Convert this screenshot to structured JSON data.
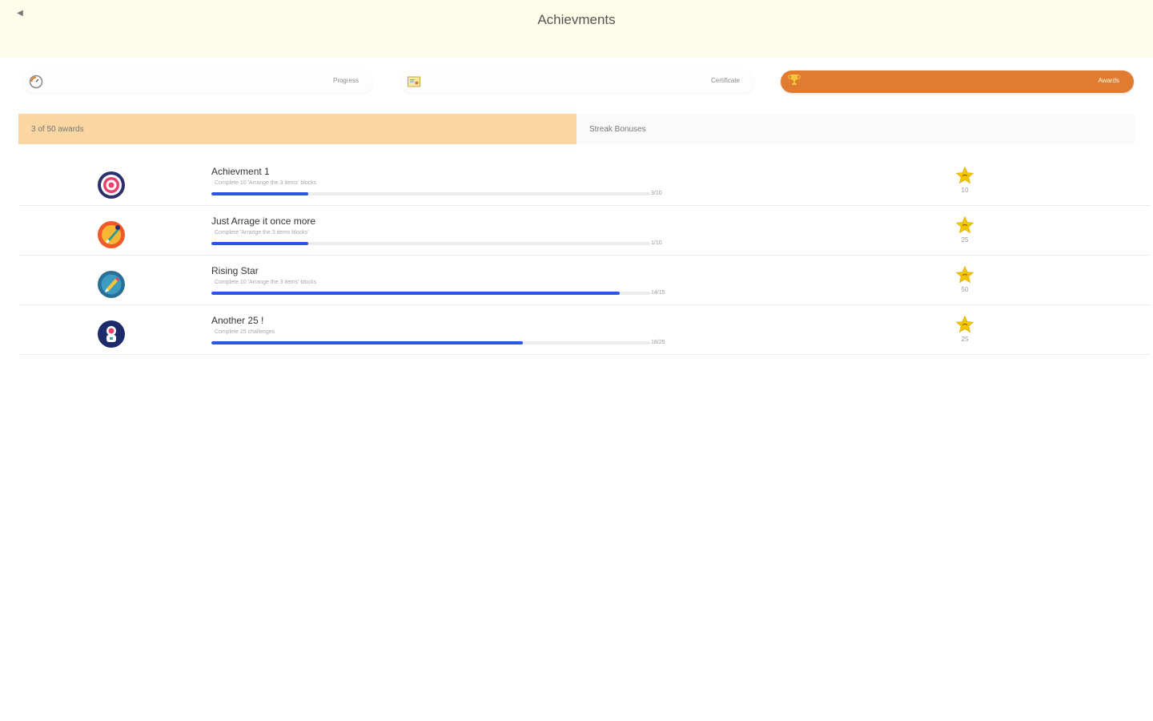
{
  "header": {
    "title": "Achievments",
    "back_icon": "back-icon"
  },
  "nav_tabs": [
    {
      "label": "Progress",
      "icon": "gauge-icon"
    },
    {
      "label": "Certificate",
      "icon": "certificate-icon"
    },
    {
      "label": "Awards",
      "icon": "trophy-icon",
      "active": true
    }
  ],
  "sub_tabs": [
    {
      "label": "3 of 50 awards",
      "active": true
    },
    {
      "label": "Streak Bonuses",
      "active": false
    }
  ],
  "achievements": [
    {
      "name": "Achievment 1",
      "description": "Complete 10 'Arrange the 3 items' blocks",
      "progress_text": "3/10",
      "progress": 0.22,
      "points": "10",
      "badge_icon": "target-badge-icon"
    },
    {
      "name": "Just Arrage it once more",
      "description": "Complete 'Arrange the 3 items blocks'",
      "progress_text": "1/10",
      "progress": 0.22,
      "points": "25",
      "badge_icon": "rocket-badge-icon"
    },
    {
      "name": "Rising Star",
      "description": "Complete 10 'Arrange the 3 items' blocks",
      "progress_text": "14/15",
      "progress": 0.93,
      "points": "50",
      "badge_icon": "pencil-badge-icon"
    },
    {
      "name": "Another 25 !",
      "description": "Complete 25 challenges",
      "progress_text": "18/25",
      "progress": 0.71,
      "points": "25",
      "badge_icon": "astronaut-badge-icon"
    }
  ],
  "colors": {
    "header_bg": "#fefde9",
    "awards_tab": "#e07b30",
    "sub_tab_active": "#fad7a2",
    "progress_fill": "#2a55e6",
    "star": "#f2c500"
  }
}
